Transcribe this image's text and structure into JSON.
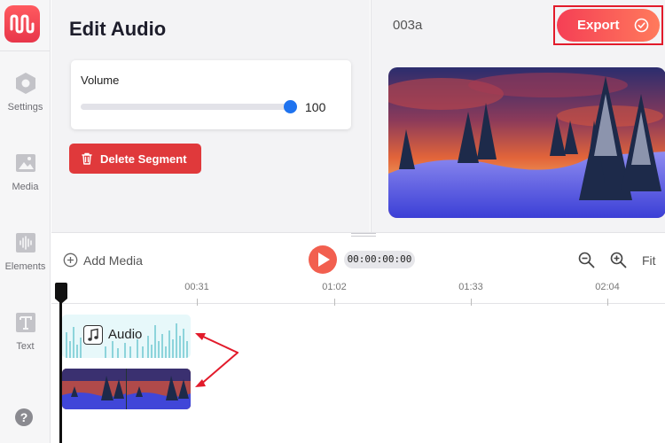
{
  "sidebar": {
    "logo": "app-logo-waveform",
    "items": [
      {
        "label": "Settings",
        "icon": "hexagon-settings-icon"
      },
      {
        "label": "Media",
        "icon": "image-icon"
      },
      {
        "label": "Elements",
        "icon": "waveform-icon"
      },
      {
        "label": "Text",
        "icon": "text-t-icon"
      }
    ],
    "help_glyph": "?"
  },
  "edit_panel": {
    "title": "Edit Audio",
    "volume": {
      "label": "Volume",
      "value": "100",
      "level": 1.0
    },
    "delete_button": "Delete Segment"
  },
  "preview": {
    "project_name": "003a",
    "export_button": "Export"
  },
  "timeline": {
    "add_media": "Add Media",
    "timecode": "00:00:00:00",
    "fit": "Fit",
    "ticks": [
      "00:31",
      "01:02",
      "01:33",
      "02:04"
    ],
    "tracks": {
      "audio_label": "Audio"
    }
  },
  "colors": {
    "brand": "#f0445a",
    "accent_blue": "#1f73ef",
    "delete_red": "#e0393b",
    "annotation_red": "#e21b2b"
  }
}
